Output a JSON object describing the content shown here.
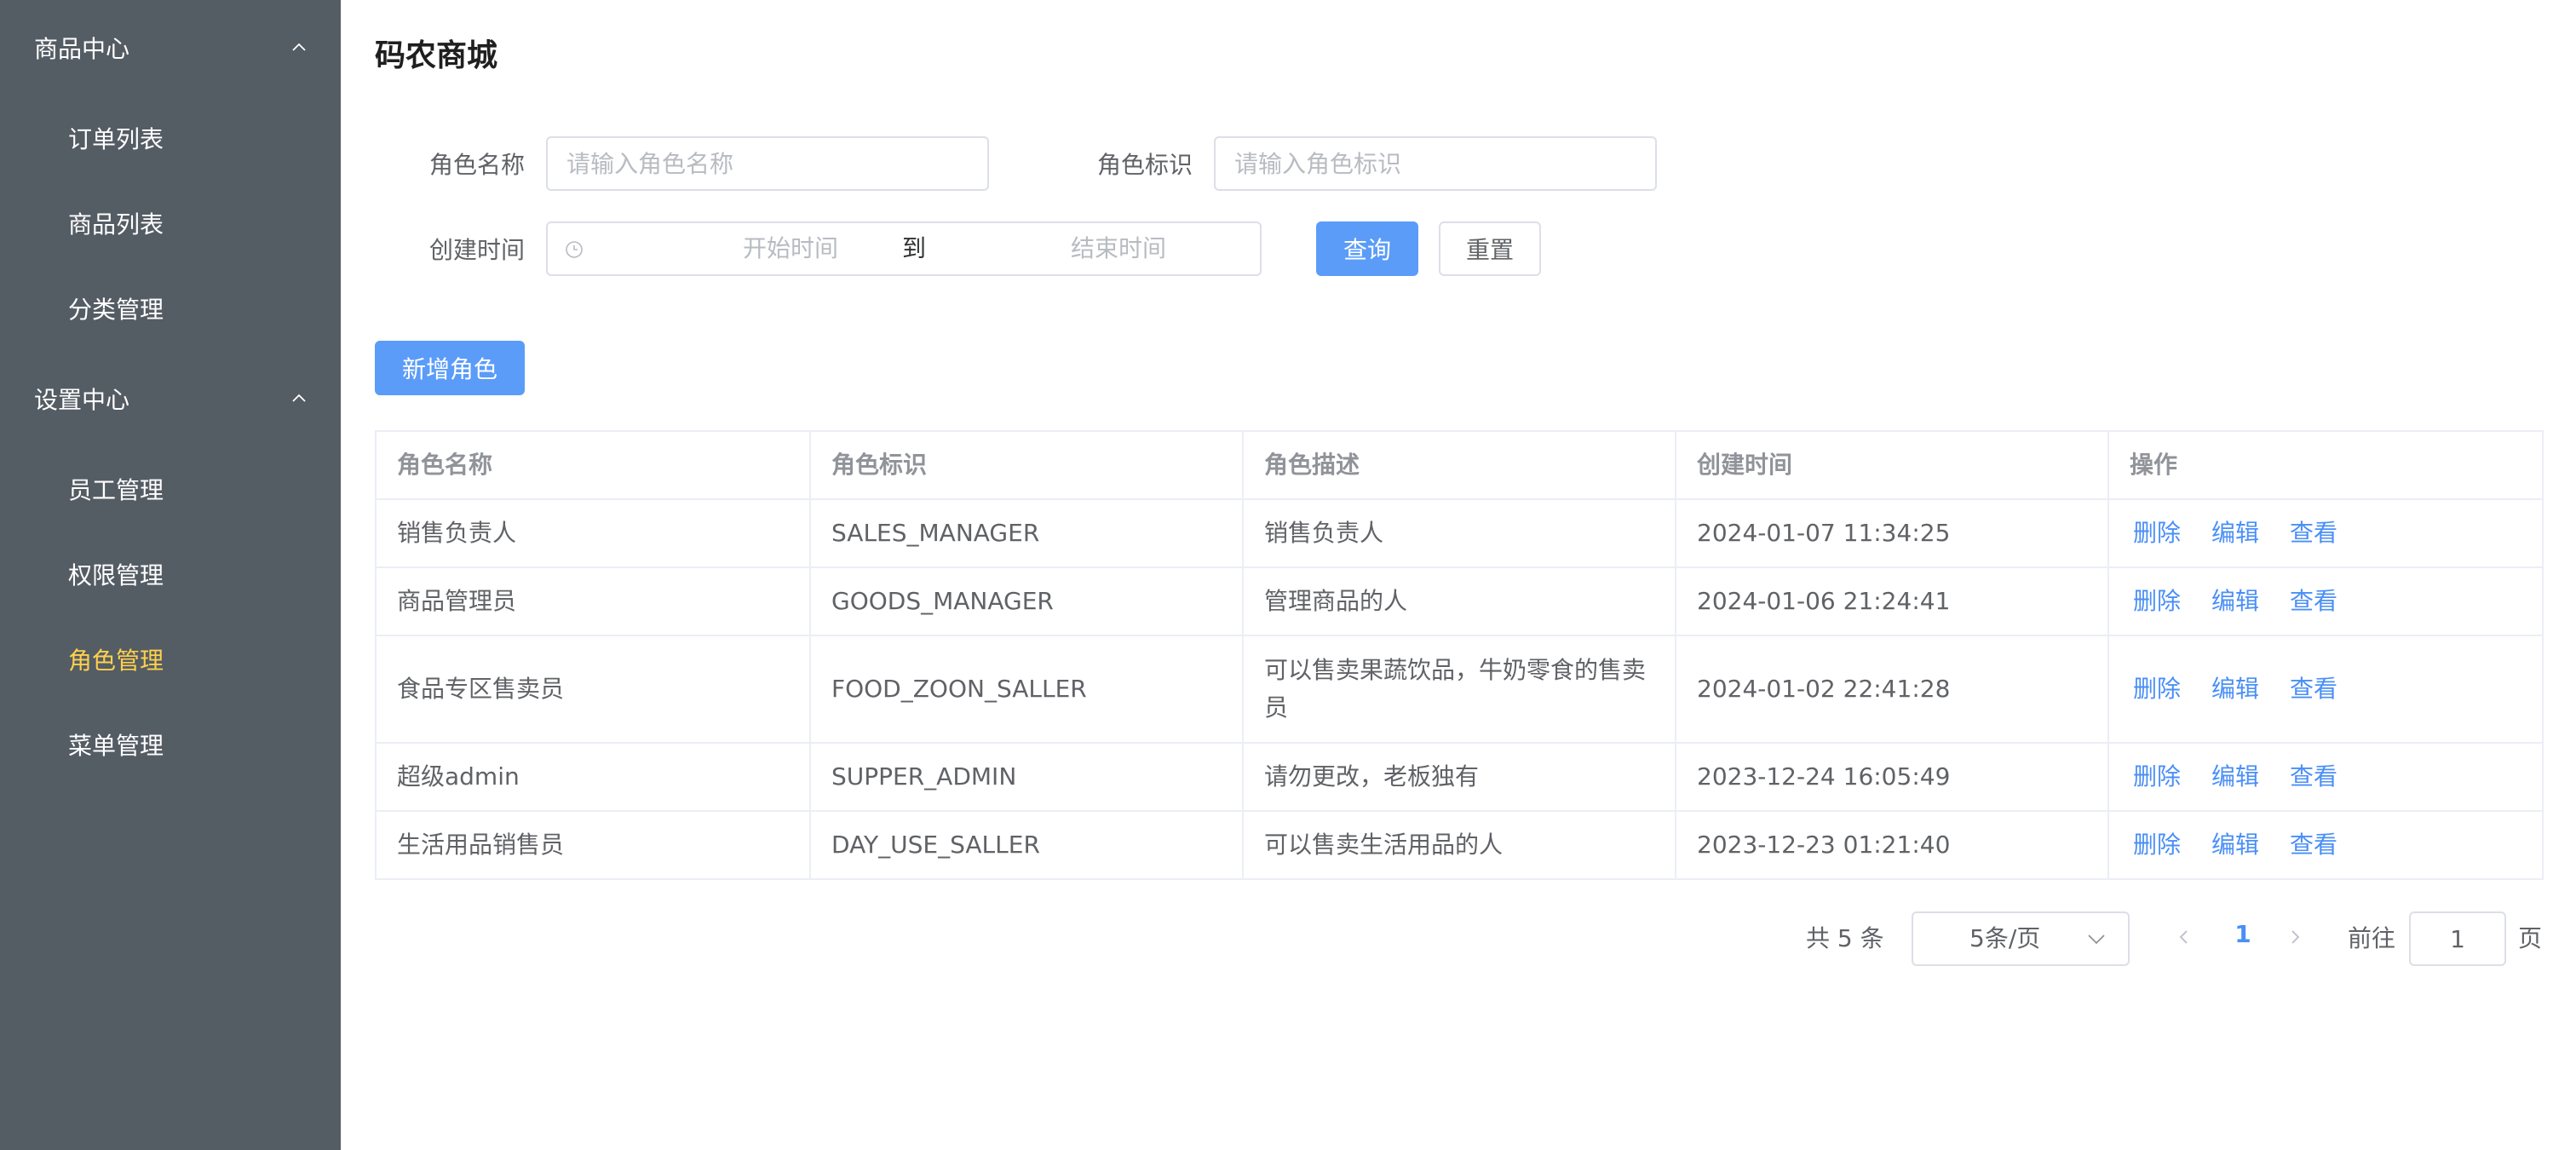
{
  "sidebar": {
    "groups": [
      {
        "label": "商品中心",
        "items": [
          "订单列表",
          "商品列表",
          "分类管理"
        ]
      },
      {
        "label": "设置中心",
        "items": [
          "员工管理",
          "权限管理",
          "角色管理",
          "菜单管理"
        ]
      }
    ],
    "active_item": "角色管理",
    "colors": {
      "background": "#545c64",
      "text": "#ffffff",
      "active": "#ffd04b"
    }
  },
  "header": {
    "brand": "码农商城"
  },
  "search": {
    "role_name_label": "角色名称",
    "role_name_placeholder": "请输入角色名称",
    "role_key_label": "角色标识",
    "role_key_placeholder": "请输入角色标识",
    "created_label": "创建时间",
    "start_placeholder": "开始时间",
    "range_separator": "到",
    "end_placeholder": "结束时间",
    "query_button": "查询",
    "reset_button": "重置"
  },
  "toolbar": {
    "add_button": "新增角色"
  },
  "table": {
    "columns": [
      "角色名称",
      "角色标识",
      "角色描述",
      "创建时间",
      "操作"
    ],
    "rows": [
      {
        "name": "销售负责人",
        "key": "SALES_MANAGER",
        "desc": "销售负责人",
        "created": "2024-01-07 11:34:25"
      },
      {
        "name": "商品管理员",
        "key": "GOODS_MANAGER",
        "desc": "管理商品的人",
        "created": "2024-01-06 21:24:41"
      },
      {
        "name": "食品专区售卖员",
        "key": "FOOD_ZOON_SALLER",
        "desc": "可以售卖果蔬饮品，牛奶零食的售卖员",
        "created": "2024-01-02 22:41:28"
      },
      {
        "name": "超级admin",
        "key": "SUPPER_ADMIN",
        "desc": "请勿更改，老板独有",
        "created": "2023-12-24 16:05:49"
      },
      {
        "name": "生活用品销售员",
        "key": "DAY_USE_SALLER",
        "desc": "可以售卖生活用品的人",
        "created": "2023-12-23 01:21:40"
      }
    ],
    "actions": [
      "删除",
      "编辑",
      "查看"
    ]
  },
  "pagination": {
    "total_text": "共 5 条",
    "page_size": "5条/页",
    "current_page": "1",
    "goto_label": "前往",
    "goto_value": "1",
    "page_suffix": "页"
  },
  "colors": {
    "primary": "#5b9cf8",
    "link": "#4a8ff7",
    "border": "#dcdfe6"
  }
}
